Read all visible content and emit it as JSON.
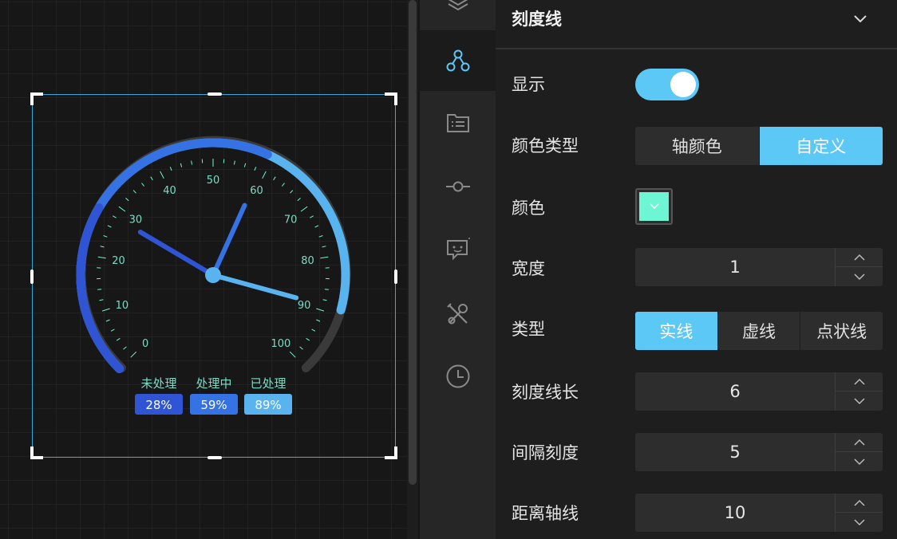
{
  "gauge": {
    "ticks": [
      "0",
      "10",
      "20",
      "30",
      "40",
      "50",
      "60",
      "70",
      "80",
      "90",
      "100"
    ],
    "hands": [
      {
        "name": "未处理",
        "value": 28,
        "color": "#2f55d4"
      },
      {
        "name": "处理中",
        "value": 59,
        "color": "#3572e3"
      },
      {
        "name": "已处理",
        "value": 89,
        "color": "#58b3ee"
      }
    ],
    "legend": [
      {
        "name": "未处理",
        "value_text": "28%",
        "color": "#2f55d4"
      },
      {
        "name": "处理中",
        "value_text": "59%",
        "color": "#3572e3"
      },
      {
        "name": "已处理",
        "value_text": "89%",
        "color": "#58b3ee"
      }
    ],
    "tick_color": "#6ef5d4",
    "track_color": "#3a3a3a"
  },
  "rail": {
    "items": [
      "layers-icon",
      "series-icon",
      "list-icon",
      "axis-icon",
      "tooltip-icon",
      "tools-icon",
      "clock-icon"
    ]
  },
  "panel": {
    "title": "刻度线",
    "show_label": "显示",
    "show_on": true,
    "color_type_label": "颜色类型",
    "color_type_options": [
      "轴颜色",
      "自定义"
    ],
    "color_type_selected": "自定义",
    "color_label": "颜色",
    "color_value": "#6ef5d4",
    "width_label": "宽度",
    "width_value": "1",
    "type_label": "类型",
    "type_options": [
      "实线",
      "虚线",
      "点状线"
    ],
    "type_selected": "实线",
    "tick_length_label": "刻度线长",
    "tick_length_value": "6",
    "interval_label": "间隔刻度",
    "interval_value": "5",
    "distance_label": "距离轴线",
    "distance_value": "10"
  },
  "colors": {
    "accent": "#5bc8f5",
    "panel_bg": "#1e1e1e",
    "rail_bg": "#262626"
  }
}
